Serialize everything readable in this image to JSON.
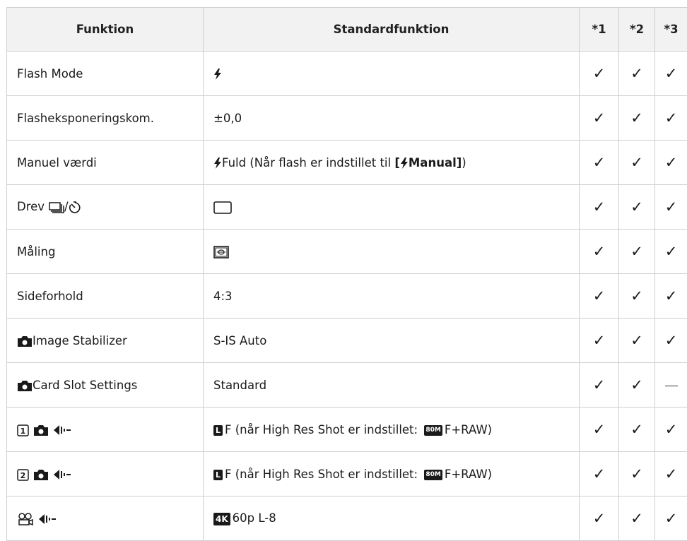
{
  "header": {
    "funktion": "Funktion",
    "standard": "Standardfunktion",
    "col1": "*1",
    "col2": "*2",
    "col3": "*3"
  },
  "rows": [
    {
      "funktion": "Flash Mode",
      "standard": "",
      "marks": [
        "✓",
        "✓",
        "✓"
      ]
    },
    {
      "funktion": "Flasheksponeringskom.",
      "standard": "±0,0",
      "marks": [
        "✓",
        "✓",
        "✓"
      ]
    },
    {
      "funktion": "Manuel værdi",
      "standard_text": "Fuld (Når flash er indstillet til ",
      "standard_bracket_open": "[",
      "standard_bold": "Manual]",
      "standard_close": ")",
      "marks": [
        "✓",
        "✓",
        "✓"
      ]
    },
    {
      "funktion": "Drev",
      "funktion_sep": "/",
      "marks": [
        "✓",
        "✓",
        "✓"
      ]
    },
    {
      "funktion": "Måling",
      "marks": [
        "✓",
        "✓",
        "✓"
      ]
    },
    {
      "funktion": "Sideforhold",
      "standard": "4:3",
      "marks": [
        "✓",
        "✓",
        "✓"
      ]
    },
    {
      "funktion": "Image Stabilizer",
      "standard": "S-IS Auto",
      "marks": [
        "✓",
        "✓",
        "✓"
      ]
    },
    {
      "funktion": "Card Slot Settings",
      "standard": "Standard",
      "marks": [
        "✓",
        "✓",
        "—"
      ]
    },
    {
      "funktion_badge": "1",
      "standard_L": "L",
      "standard_a": "F (når High Res Shot er indstillet: ",
      "standard_80": "80M",
      "standard_b": "F+RAW)",
      "marks": [
        "✓",
        "✓",
        "✓"
      ]
    },
    {
      "funktion_badge": "2",
      "standard_L": "L",
      "standard_a": "F (når High Res Shot er indstillet: ",
      "standard_80": "80M",
      "standard_b": "F+RAW)",
      "marks": [
        "✓",
        "✓",
        "✓"
      ]
    },
    {
      "standard_4k": "4K",
      "standard": "60p L-8",
      "marks": [
        "✓",
        "✓",
        "✓"
      ]
    }
  ],
  "icons": {
    "flash": "flash-icon",
    "sequential": "sequential-shooting-icon",
    "self_timer": "self-timer-icon",
    "single_frame": "single-frame-icon",
    "metering": "metering-icon",
    "camera": "camera-icon",
    "image_quality": "image-quality-icon",
    "video": "video-icon"
  }
}
